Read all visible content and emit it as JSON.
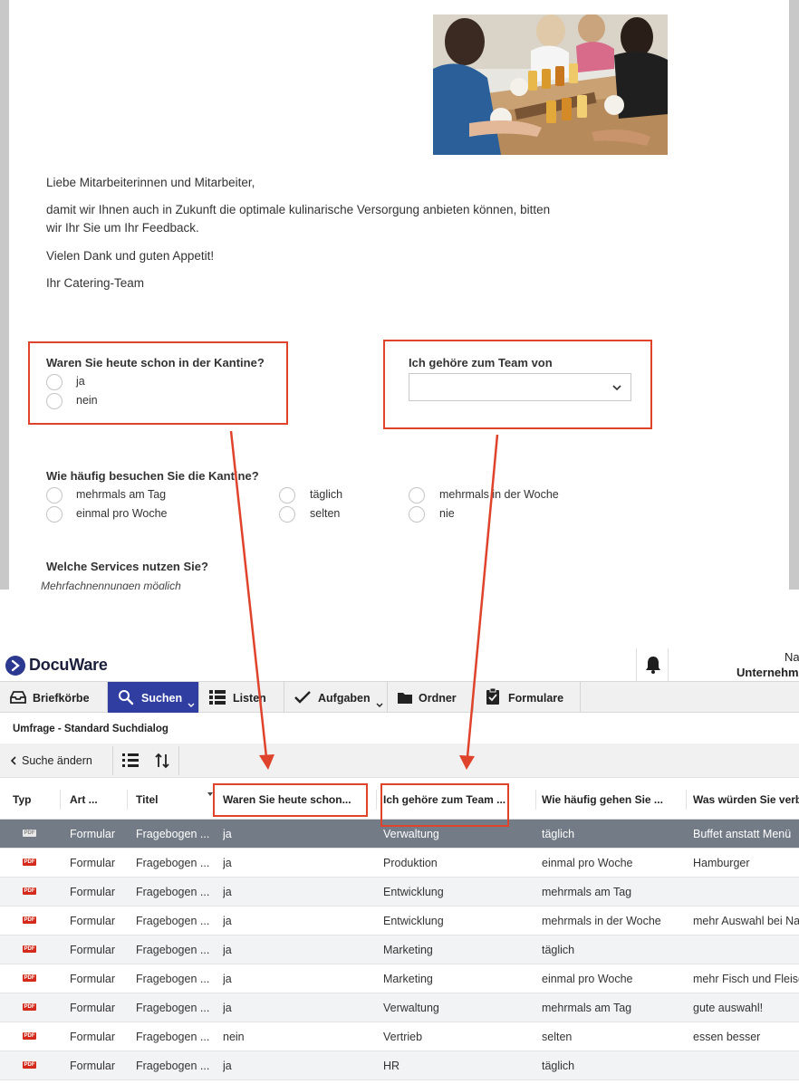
{
  "form": {
    "greeting": "Liebe Mitarbeiterinnen und Mitarbeiter,",
    "body_line1": "damit wir Ihnen auch in Zukunft die optimale kulinarische Versorgung anbieten können, bitten",
    "body_line2": "wir Ihr Sie um Ihr Feedback.",
    "thanks": "Vielen Dank und guten Appetit!",
    "signature": "Ihr Catering-Team",
    "q1": {
      "label": "Waren Sie heute schon in der Kantine?",
      "options": [
        "ja",
        "nein"
      ]
    },
    "q2": {
      "label": "Ich gehöre zum Team von",
      "selected": ""
    },
    "q3": {
      "label": "Wie häufig besuchen Sie die Kantine?",
      "options": [
        "mehrmals am Tag",
        "täglich",
        "mehrmals in der Woche",
        "einmal pro Woche",
        "selten",
        "nie"
      ]
    },
    "q4": {
      "label": "Welche Services nutzen Sie?",
      "hint": "Mehrfachnennungen möglich"
    }
  },
  "app": {
    "logo": "DocuWare",
    "user_name": "Na",
    "user_company": "Unternehm",
    "nav": [
      "Briefkörbe",
      "Suchen",
      "Listen",
      "Aufgaben",
      "Ordner",
      "Formulare"
    ],
    "breadcrumb": "Umfrage - Standard Suchdialog",
    "back_label": "Suche ändern"
  },
  "table": {
    "columns": [
      "Typ",
      "Art ...",
      "Titel",
      "Waren Sie heute schon...",
      "Ich gehöre zum Team ...",
      "Wie häufig gehen Sie ...",
      "Was würden Sie verb"
    ],
    "rows": [
      {
        "type": "PDF",
        "art": "Formular",
        "titel": "Fragebogen ...",
        "q1": "ja",
        "team": "Verwaltung",
        "freq": "täglich",
        "wish": "Buffet anstatt Menü"
      },
      {
        "type": "PDF",
        "art": "Formular",
        "titel": "Fragebogen ...",
        "q1": "ja",
        "team": "Produktion",
        "freq": "einmal pro Woche",
        "wish": "Hamburger"
      },
      {
        "type": "PDF",
        "art": "Formular",
        "titel": "Fragebogen ...",
        "q1": "ja",
        "team": "Entwicklung",
        "freq": "mehrmals am Tag",
        "wish": ""
      },
      {
        "type": "PDF",
        "art": "Formular",
        "titel": "Fragebogen ...",
        "q1": "ja",
        "team": "Entwicklung",
        "freq": "mehrmals in der Woche",
        "wish": "mehr Auswahl bei Na"
      },
      {
        "type": "PDF",
        "art": "Formular",
        "titel": "Fragebogen ...",
        "q1": "ja",
        "team": "Marketing",
        "freq": "täglich",
        "wish": ""
      },
      {
        "type": "PDF",
        "art": "Formular",
        "titel": "Fragebogen ...",
        "q1": "ja",
        "team": "Marketing",
        "freq": "einmal pro Woche",
        "wish": "mehr Fisch und Fleisc"
      },
      {
        "type": "PDF",
        "art": "Formular",
        "titel": "Fragebogen ...",
        "q1": "ja",
        "team": "Verwaltung",
        "freq": "mehrmals am Tag",
        "wish": "gute auswahl!"
      },
      {
        "type": "PDF",
        "art": "Formular",
        "titel": "Fragebogen ...",
        "q1": "nein",
        "team": "Vertrieb",
        "freq": "selten",
        "wish": "essen besser"
      },
      {
        "type": "PDF",
        "art": "Formular",
        "titel": "Fragebogen ...",
        "q1": "ja",
        "team": "HR",
        "freq": "täglich",
        "wish": ""
      }
    ],
    "selected_row": 0
  },
  "colors": {
    "brand": "#2b3990",
    "active_nav": "#2f3ea0",
    "selected_row": "#727b86",
    "highlight": "#e0432b",
    "pdf_icon": "#d42a1b"
  },
  "icons": [
    "inbox-icon",
    "search-icon",
    "list-icon",
    "checkmark-icon",
    "folder-icon",
    "clipboard-icon",
    "bell-icon",
    "chevron-left-icon",
    "columns-icon",
    "sort-icon",
    "chevron-down-icon",
    "pdf-icon"
  ]
}
